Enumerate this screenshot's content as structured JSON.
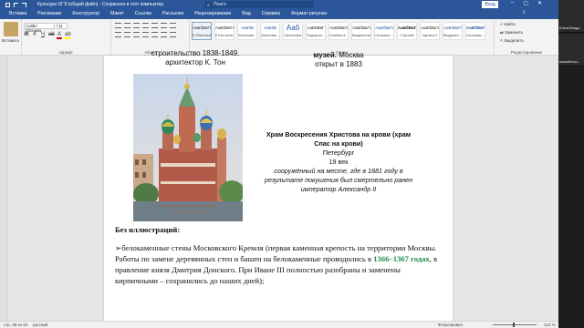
{
  "titlebar": {
    "doc_title": "Культура ОГЭ (общий файл) - Сохранено в этот компьютер",
    "search_placeholder": "Поиск",
    "signin": "Вход"
  },
  "tabs": [
    {
      "label": "Вставка",
      "active": false
    },
    {
      "label": "Рисование",
      "active": false
    },
    {
      "label": "Конструктор",
      "active": false
    },
    {
      "label": "Макет",
      "active": false
    },
    {
      "label": "Ссылки",
      "active": false
    },
    {
      "label": "Рассылки",
      "active": false
    },
    {
      "label": "Рецензирование",
      "active": false
    },
    {
      "label": "Вид",
      "active": false
    },
    {
      "label": "Справка",
      "active": false
    },
    {
      "label": "Формат рисунка",
      "active": true
    }
  ],
  "ribbon": {
    "paste_label": "Вставить",
    "clipboard_group": "Буфер обмена",
    "font_name": "Calibri (Основн",
    "font_size": "11",
    "font_group": "Шрифт",
    "paragraph_group": "Абзац",
    "styles_group": "Стили",
    "styles": [
      {
        "sample": "АаБбВвГг",
        "name": "¶ Обычный",
        "selected": true
      },
      {
        "sample": "АаБбВвГг",
        "name": "¶ Без инте..."
      },
      {
        "sample": "АаБбВ",
        "name": "Заголово..."
      },
      {
        "sample": "АаБбВ",
        "name": "Заголово..."
      },
      {
        "sample": "Ааб",
        "name": "Заголовок",
        "big": true
      },
      {
        "sample": "АаБбВвГ",
        "name": "Подзагол..."
      },
      {
        "sample": "АаБбВвГг",
        "name": "Слабое в..."
      },
      {
        "sample": "АаБбВвГг",
        "name": "Выделение"
      },
      {
        "sample": "АаБбВвГг",
        "name": "Сильное..."
      },
      {
        "sample": "АаБбВвГг",
        "name": "Строгий"
      },
      {
        "sample": "АаБбВвГг",
        "name": "Цитата 2"
      },
      {
        "sample": "АаБбВвГг",
        "name": "Выделен..."
      },
      {
        "sample": "АаБбВвГг",
        "name": "Сильная..."
      }
    ],
    "editing": {
      "find": "Найти",
      "replace": "Заменить",
      "select": "Выделить",
      "group": "Редактирование"
    }
  },
  "document": {
    "left_top": "строительство 1838-1849.\nархитектор К. Тон",
    "right_top_bold": "музей.",
    "right_top_rest": " Москва\nоткрыт в 1883",
    "desc_title": "Храм Воскресения Христова на крови (храм Спас на крови)",
    "desc_city": "Петербург",
    "desc_century": "19 век",
    "desc_italic": "сооружённый на месте, где в 1881 году в результате покушения был смертельно ранен император Александр II",
    "heading": "Без иллюстраций:",
    "para_1": "➢белокаменные стены Московского Кремля (первая каменная крепость на территории Москвы. Работы по замене деревянных стен и башен на белокаменные проводились в ",
    "para_green": "1366–1367 годах",
    "para_2": ", в правление князя Дмитрия Донского. При Иване III полностью разобраны и заменены кирпичными – сохранились до наших дней);",
    "para_2_bold": "в правление князя Дмитрия"
  },
  "video_panel": {
    "users": [
      "Елена Влади...",
      "алексей коз..."
    ]
  },
  "statusbar": {
    "page_info": "стр. 36 из 62",
    "language": "русский",
    "focus": "Фокусировка",
    "zoom": "121 %"
  }
}
